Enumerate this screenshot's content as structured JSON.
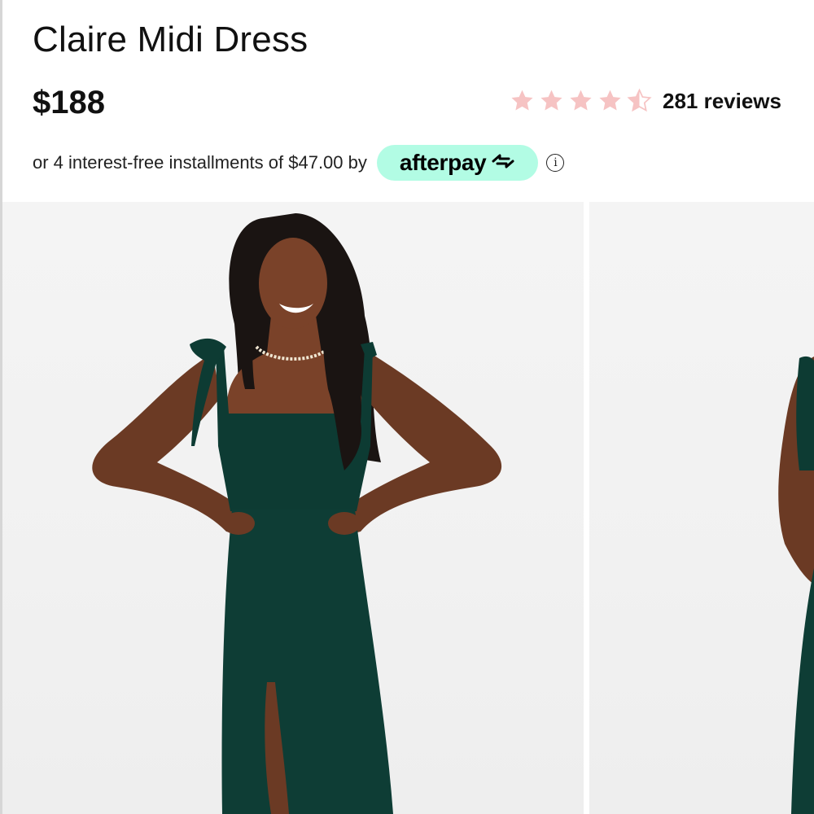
{
  "product": {
    "title": "Claire Midi Dress",
    "price": "$188"
  },
  "rating": {
    "value": 4.5,
    "max": 5,
    "star_color": "#f6c3c3",
    "reviews_label": "281 reviews"
  },
  "installments": {
    "text": "or 4 interest-free installments of $47.00 by",
    "provider": "afterpay",
    "badge_color": "#b2fce4",
    "info_icon": "info-icon"
  },
  "gallery": {
    "images": [
      {
        "alt": "model-front-view",
        "dress_color": "#0d3b33"
      },
      {
        "alt": "model-side-view",
        "dress_color": "#0d3b33"
      }
    ]
  }
}
